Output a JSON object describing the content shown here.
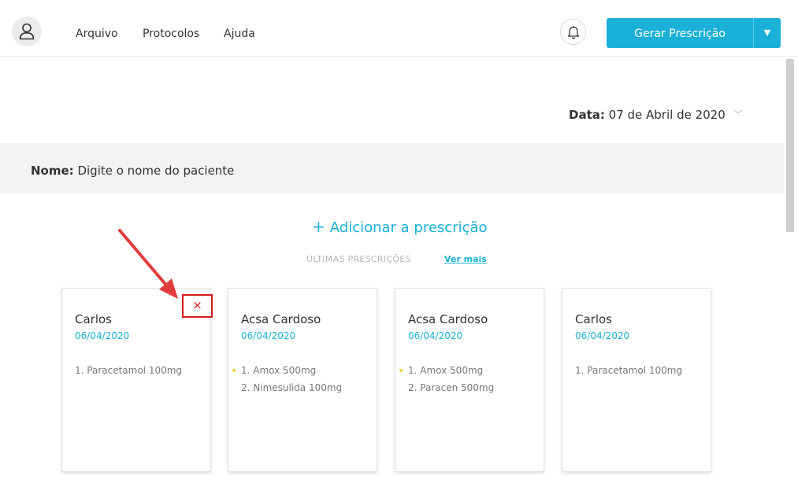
{
  "header": {
    "nav": [
      "Arquivo",
      "Protocolos",
      "Ajuda"
    ],
    "generate_button": "Gerar Prescrição",
    "generate_caret": "▼"
  },
  "date": {
    "label": "Data:",
    "value": "07 de Abril de 2020",
    "chevron": "﹀"
  },
  "patient": {
    "label": "Nome:",
    "placeholder": "Digite o nome do paciente"
  },
  "add_prescription": {
    "plus": "+",
    "label": "Adicionar a prescrição"
  },
  "recent": {
    "title": "ÚLTIMAS PRESCRIÇÕES",
    "see_more": "Ver mais"
  },
  "cards": [
    {
      "name": "Carlos",
      "date": "06/04/2020",
      "meds": [
        "1. Paracetamol 100mg"
      ],
      "dot": false,
      "close": "×"
    },
    {
      "name": "Acsa Cardoso",
      "date": "06/04/2020",
      "meds": [
        "1. Amox 500mg",
        "2. Nimesulida 100mg"
      ],
      "dot": true
    },
    {
      "name": "Acsa Cardoso",
      "date": "06/04/2020",
      "meds": [
        "1. Amox 500mg",
        "2. Paracen 500mg"
      ],
      "dot": true
    },
    {
      "name": "Carlos",
      "date": "06/04/2020",
      "meds": [
        "1. Paracetamol 100mg"
      ],
      "dot": false
    }
  ],
  "colors": {
    "accent": "#1ab0d8",
    "highlight": "#d21c1c",
    "bullet": "#f5d23a"
  },
  "icons": {
    "avatar": "user-icon",
    "notifications": "bell-icon",
    "close": "close-icon",
    "annotation": "arrow-icon"
  }
}
